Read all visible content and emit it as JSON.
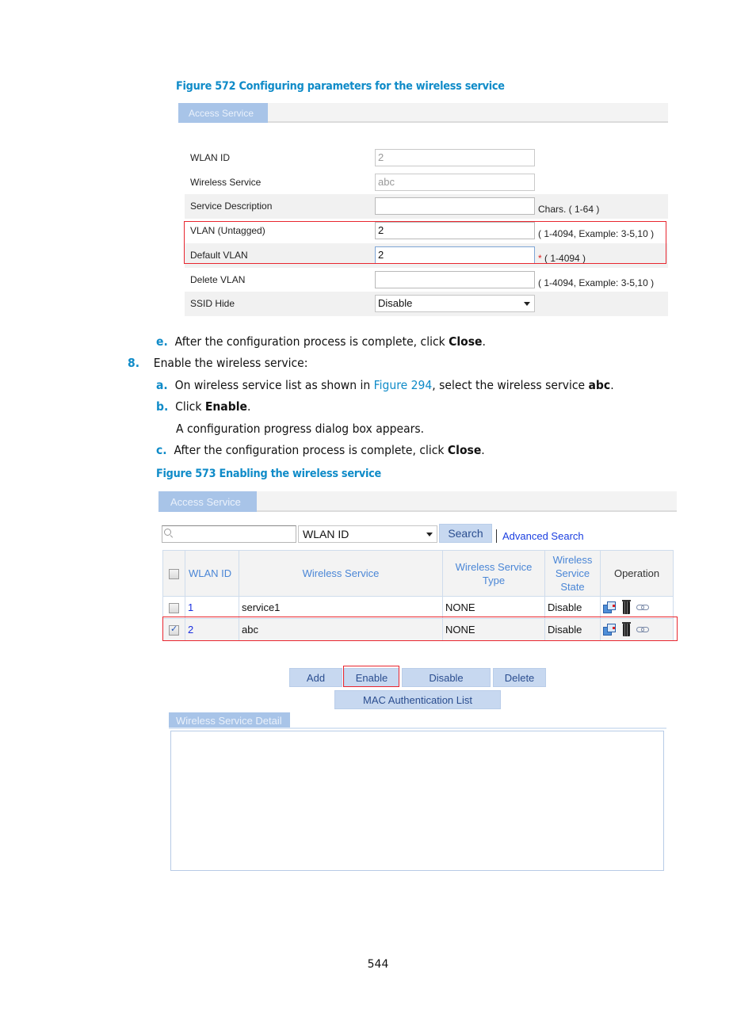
{
  "figure572": {
    "caption": "Figure 572 Configuring parameters for the wireless service",
    "tab_label": "Access Service",
    "rows": [
      {
        "label": "WLAN ID",
        "value": "2",
        "hint": "",
        "required": false
      },
      {
        "label": "Wireless Service",
        "value": "abc",
        "hint": "",
        "required": false
      },
      {
        "label": "Service Description",
        "value": "",
        "hint": "Chars. ( 1-64 )",
        "required": false
      },
      {
        "label": "VLAN (Untagged)",
        "value": "2",
        "hint": "( 1-4094, Example: 3-5,10 )",
        "required": false
      },
      {
        "label": "Default VLAN",
        "value": "2",
        "hint": "( 1-4094 )",
        "required": true,
        "required_mark": "*"
      },
      {
        "label": "Delete VLAN",
        "value": "",
        "hint": "( 1-4094, Example: 3-5,10 )",
        "required": false
      },
      {
        "label": "SSID Hide",
        "value": "Disable",
        "hint": "",
        "required": false
      }
    ]
  },
  "steps": {
    "e": {
      "marker": "e.",
      "text": "After the configuration process is complete, click ",
      "bold": "Close",
      "end": "."
    },
    "step8": {
      "marker": "8.",
      "text": "Enable the wireless service:"
    },
    "a": {
      "marker": "a.",
      "text_before": "On wireless service list as shown in ",
      "link": "Figure 294",
      "text_mid": ", select the wireless service ",
      "bold": "abc",
      "end": "."
    },
    "b": {
      "marker": "b.",
      "text": "Click ",
      "bold": "Enable",
      "end": "."
    },
    "b_note": "A configuration progress dialog box appears.",
    "c": {
      "marker": "c.",
      "text": "After the configuration process is complete, click ",
      "bold": "Close",
      "end": "."
    }
  },
  "figure573": {
    "caption": "Figure 573 Enabling the wireless service",
    "tab_label": "Access Service",
    "search": {
      "placeholder": "",
      "field_selected": "WLAN ID",
      "search_button": "Search",
      "advanced_link": "Advanced Search"
    },
    "table": {
      "headers": [
        "WLAN ID",
        "Wireless Service",
        "Wireless Service Type",
        "Wireless Service State",
        "Operation"
      ],
      "header_lines": {
        "type": [
          "Wireless Service",
          "Type"
        ],
        "state": [
          "Wireless",
          "Service",
          "State"
        ]
      },
      "rows": [
        {
          "checked": false,
          "wlan_id": "1",
          "service": "service1",
          "type": "NONE",
          "state": "Disable"
        },
        {
          "checked": true,
          "wlan_id": "2",
          "service": "abc",
          "type": "NONE",
          "state": "Disable"
        }
      ],
      "operation_icons": [
        "edit-icon",
        "delete-icon",
        "bind-icon"
      ]
    },
    "buttons": {
      "add": "Add",
      "enable": "Enable",
      "disable": "Disable",
      "delete": "Delete",
      "mac_auth": "MAC Authentication List"
    },
    "detail_tab_label": "Wireless Service Detail"
  },
  "page_number": "544",
  "colors": {
    "accent": "#0f8bc8",
    "tab_bg": "#a8c4e8",
    "highlight": "#e8262f",
    "link_blue": "#1a3ee0"
  }
}
